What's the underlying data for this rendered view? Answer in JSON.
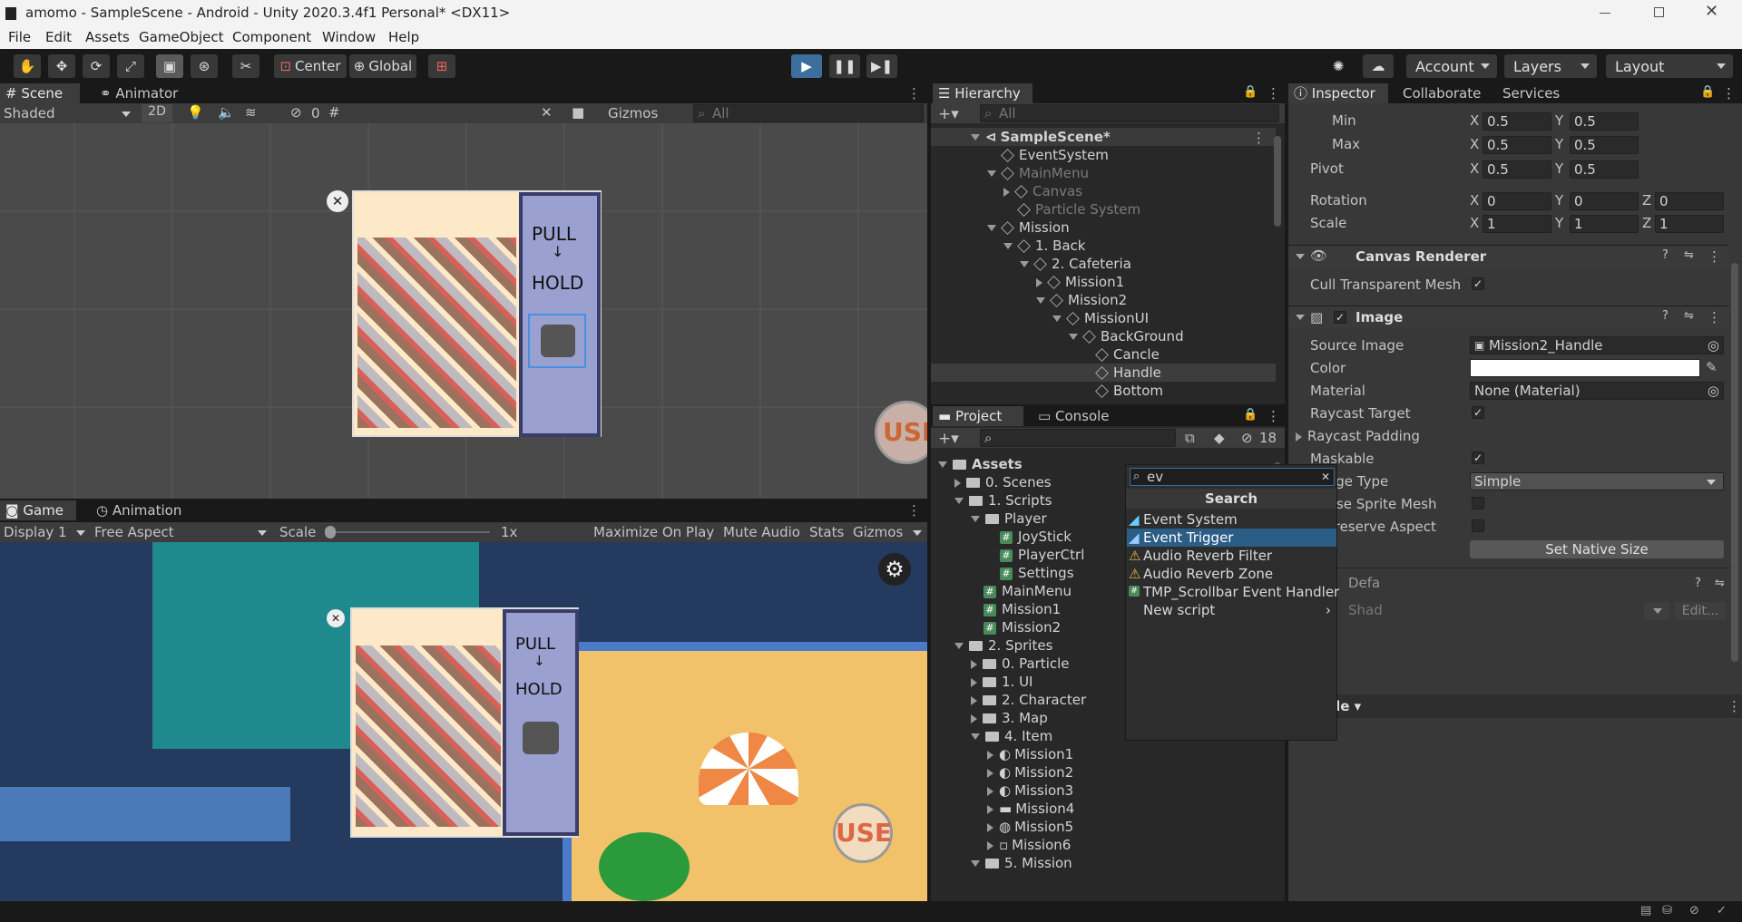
{
  "title": "amomo - SampleScene - Android - Unity 2020.3.4f1 Personal* <DX11>",
  "menu": [
    "File",
    "Edit",
    "Assets",
    "GameObject",
    "Component",
    "Window",
    "Help"
  ],
  "toolbar": {
    "center": "Center",
    "global": "Global",
    "account": "Account",
    "layers": "Layers",
    "layout": "Layout"
  },
  "scene": {
    "tabs": [
      "Scene",
      "Animator"
    ],
    "shading": "Shaded",
    "mode2d": "2D",
    "hidden_count": "0",
    "gizmos": "Gizmos",
    "search_placeholder": "All",
    "pull": "PULL",
    "arrow": "↓",
    "hold": "HOLD",
    "use": "USE"
  },
  "game": {
    "tabs": [
      "Game",
      "Animation"
    ],
    "display": "Display 1",
    "aspect": "Free Aspect",
    "scale_label": "Scale",
    "scale_value": "1x",
    "maximize": "Maximize On Play",
    "mute": "Mute Audio",
    "stats": "Stats",
    "gizmos": "Gizmos",
    "pull": "PULL",
    "arrow": "↓",
    "hold": "HOLD",
    "use": "USE"
  },
  "hierarchy": {
    "tab": "Hierarchy",
    "search_placeholder": "All",
    "items": [
      {
        "label": "SampleScene*"
      },
      {
        "label": "EventSystem"
      },
      {
        "label": "MainMenu"
      },
      {
        "label": "Canvas"
      },
      {
        "label": "Particle System"
      },
      {
        "label": "Mission"
      },
      {
        "label": "1. Back"
      },
      {
        "label": "2. Cafeteria"
      },
      {
        "label": "Mission1"
      },
      {
        "label": "Mission2"
      },
      {
        "label": "MissionUI"
      },
      {
        "label": "BackGround"
      },
      {
        "label": "Cancle"
      },
      {
        "label": "Handle"
      },
      {
        "label": "Bottom"
      }
    ]
  },
  "project": {
    "tabs": [
      "Project",
      "Console"
    ],
    "hidden_count": "18",
    "items": [
      {
        "label": "Assets"
      },
      {
        "label": "0. Scenes"
      },
      {
        "label": "1. Scripts"
      },
      {
        "label": "Player"
      },
      {
        "label": "JoyStick"
      },
      {
        "label": "PlayerCtrl"
      },
      {
        "label": "Settings"
      },
      {
        "label": "MainMenu"
      },
      {
        "label": "Mission1"
      },
      {
        "label": "Mission2"
      },
      {
        "label": "2. Sprites"
      },
      {
        "label": "0. Particle"
      },
      {
        "label": "1. UI"
      },
      {
        "label": "2. Character"
      },
      {
        "label": "3. Map"
      },
      {
        "label": "4. Item"
      },
      {
        "label": "Mission1"
      },
      {
        "label": "Mission2"
      },
      {
        "label": "Mission3"
      },
      {
        "label": "Mission4"
      },
      {
        "label": "Mission5"
      },
      {
        "label": "Mission6"
      },
      {
        "label": "5. Mission"
      }
    ]
  },
  "inspector": {
    "tabs": [
      "Inspector",
      "Collaborate",
      "Services"
    ],
    "min_label": "Min",
    "max_label": "Max",
    "pivot_label": "Pivot",
    "rotation_label": "Rotation",
    "scale_label": "Scale",
    "x": "X",
    "y": "Y",
    "z": "Z",
    "min_x": "0.5",
    "min_y": "0.5",
    "max_x": "0.5",
    "max_y": "0.5",
    "pivot_x": "0.5",
    "pivot_y": "0.5",
    "rot_x": "0",
    "rot_y": "0",
    "rot_z": "0",
    "scale_x": "1",
    "scale_y": "1",
    "scale_z": "1",
    "canvas_renderer": "Canvas Renderer",
    "cull_transparent": "Cull Transparent Mesh",
    "image": "Image",
    "source_image_label": "Source Image",
    "source_image": "Mission2_Handle",
    "color_label": "Color",
    "material_label": "Material",
    "material": "None (Material)",
    "raycast_target": "Raycast Target",
    "raycast_padding": "Raycast Padding",
    "maskable": "Maskable",
    "image_type_label": "Image Type",
    "image_type": "Simple",
    "use_sprite_mesh": "Use Sprite Mesh",
    "preserve_aspect": "Preserve Aspect",
    "set_native_size": "Set Native Size",
    "default_partial": "Defa",
    "shader_partial": "Shad",
    "edit_button": "Edit...",
    "handle_dropdown": "Handle"
  },
  "component_search": {
    "query": "ev",
    "title": "Search",
    "items": [
      {
        "label": "Event System"
      },
      {
        "label": "Event Trigger"
      },
      {
        "label": "Audio Reverb Filter"
      },
      {
        "label": "Audio Reverb Zone"
      },
      {
        "label": "TMP_Scrollbar Event Handler"
      },
      {
        "label": "New script"
      }
    ]
  }
}
